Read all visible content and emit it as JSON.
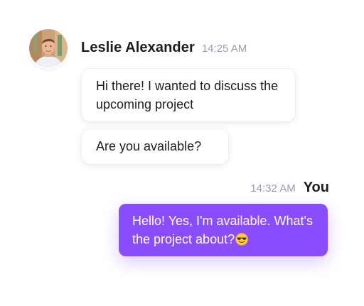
{
  "incoming": {
    "sender": "Leslie Alexander",
    "time": "14:25 AM",
    "messages": [
      "Hi there! I wanted to discuss the upcoming project",
      "Are you available?"
    ]
  },
  "outgoing": {
    "sender": "You",
    "time": "14:32 AM",
    "message": "Hello! Yes, I'm available. What's the project about?",
    "emoji": "smiling-face-with-sunglasses"
  },
  "colors": {
    "accent": "#8a4dfd",
    "text": "#1c1d21",
    "muted": "#9a9ca8",
    "bubble_incoming": "#ffffff"
  }
}
